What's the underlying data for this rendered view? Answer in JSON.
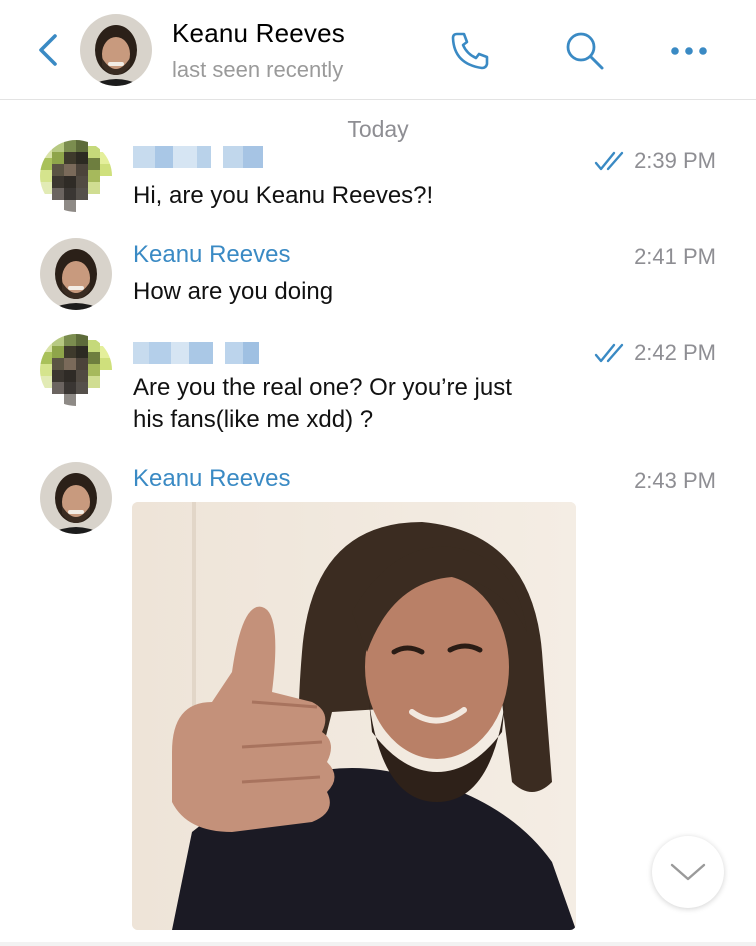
{
  "header": {
    "contact_name": "Keanu Reeves",
    "status": "last seen recently",
    "back_icon": "chevron-left-icon",
    "call_icon": "phone-icon",
    "search_icon": "search-icon",
    "more_icon": "more-dots-icon"
  },
  "colors": {
    "accent": "#3a8ac4",
    "timestamp": "#8e8e93",
    "divider": "#e3e3e3"
  },
  "chat": {
    "date_separator": "Today",
    "messages": [
      {
        "sender": "",
        "sender_blurred": true,
        "text": "Hi, are you Keanu Reeves?!",
        "time": "2:39 PM",
        "read": true
      },
      {
        "sender": "Keanu Reeves",
        "sender_blurred": false,
        "text": "How are you doing",
        "time": "2:41 PM",
        "read": false
      },
      {
        "sender": "",
        "sender_blurred": true,
        "text_line1": "Are you the real one? Or you’re just",
        "text_line2": "his fans(like me xdd) ?",
        "time": "2:42 PM",
        "read": true
      },
      {
        "sender": "Keanu Reeves",
        "sender_blurred": false,
        "attachment": "photo",
        "time": "2:43 PM",
        "read": false
      }
    ]
  },
  "scroll_down_icon": "chevron-down-icon"
}
